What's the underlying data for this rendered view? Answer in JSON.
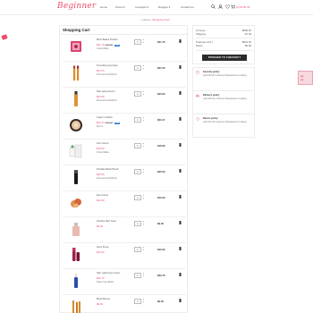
{
  "header": {
    "logo": "Beginner",
    "nav": [
      "Home",
      "Prices ▾",
      "Concepts ▾",
      "Designs ▾",
      "Contact Us"
    ],
    "cart_amount": "(2) $736.45"
  },
  "breadcrumb": {
    "home": "⌂ Home",
    "sep": "›",
    "current": "Shopping Cart"
  },
  "cart": {
    "title": "Shopping Cart",
    "items": [
      {
        "name": "Bioré Baked Powder",
        "price": "$21.75",
        "old_price": "$24.95",
        "badge": "-5%",
        "variant": "Colour/Matte",
        "qty": "1",
        "total": "$21.75"
      },
      {
        "name": "Smoothing Lipcream",
        "price": "$37.00",
        "variant": "Dimensions:30x40cm",
        "qty": "1",
        "total": "$37.00"
      },
      {
        "name": "Skin Aging Serum",
        "price": "$23.90",
        "variant": "Dimensions:30x40cm",
        "qty": "1",
        "total": "$23.90"
      },
      {
        "name": "Cream Cushion",
        "price": "$23.17",
        "old_price": "$24.39",
        "badge": "-5%",
        "variant": "Size:S",
        "qty": "1",
        "total": "$23.17"
      },
      {
        "name": "Pore Serum",
        "price": "$16.90",
        "variant": "Colour/Matte",
        "qty": "1",
        "total": "$16.90"
      },
      {
        "name": "Portable Blush Brush",
        "price": "$25.90",
        "variant": "Dimensions:30x40cm",
        "qty": "1",
        "total": "$25.90"
      },
      {
        "name": "Eau Crème",
        "price": "$12.90",
        "variant": "",
        "qty": "1",
        "total": "$12.90"
      },
      {
        "name": "Hombre Skin Toner",
        "price": "$9.00",
        "variant": "",
        "qty": "1",
        "total": "$9.00"
      },
      {
        "name": "Hemi Pump",
        "price": "$12.90",
        "variant": "",
        "qty": "1",
        "total": "$12.90"
      },
      {
        "name": "Skin Lightening Cream",
        "price": "$23.70",
        "variant": "Paper Type:Ruled",
        "qty": "1",
        "total": "$23.70"
      },
      {
        "name": "Blush Brenia",
        "price": "$9.00",
        "variant": "",
        "qty": "1",
        "total": "$9.00"
      }
    ]
  },
  "summary": {
    "items_label": "14 items",
    "items_value": "$536.45",
    "shipping_label": "Shipping",
    "shipping_value": "$7.00",
    "total_label": "Total (tax excl.)",
    "total_value": "$543.45",
    "taxes_label": "Taxes",
    "taxes_value": "$0.00",
    "checkout_label": "PROCEED TO CHECKOUT"
  },
  "reassurance": [
    {
      "title": "Security policy",
      "text": "(edit with the Customer Reassurance module)"
    },
    {
      "title": "Delivery policy",
      "text": "(edit with the Customer Reassurance module)"
    },
    {
      "title": "Return policy",
      "text": "(edit with the Customer Reassurance module)"
    }
  ],
  "side_widget": {
    "line1": "Aa",
    "line2": "Aa"
  },
  "colors": {
    "accent": "#e8506b",
    "badge": "#2f7fd6",
    "button": "#2b2b2b"
  }
}
